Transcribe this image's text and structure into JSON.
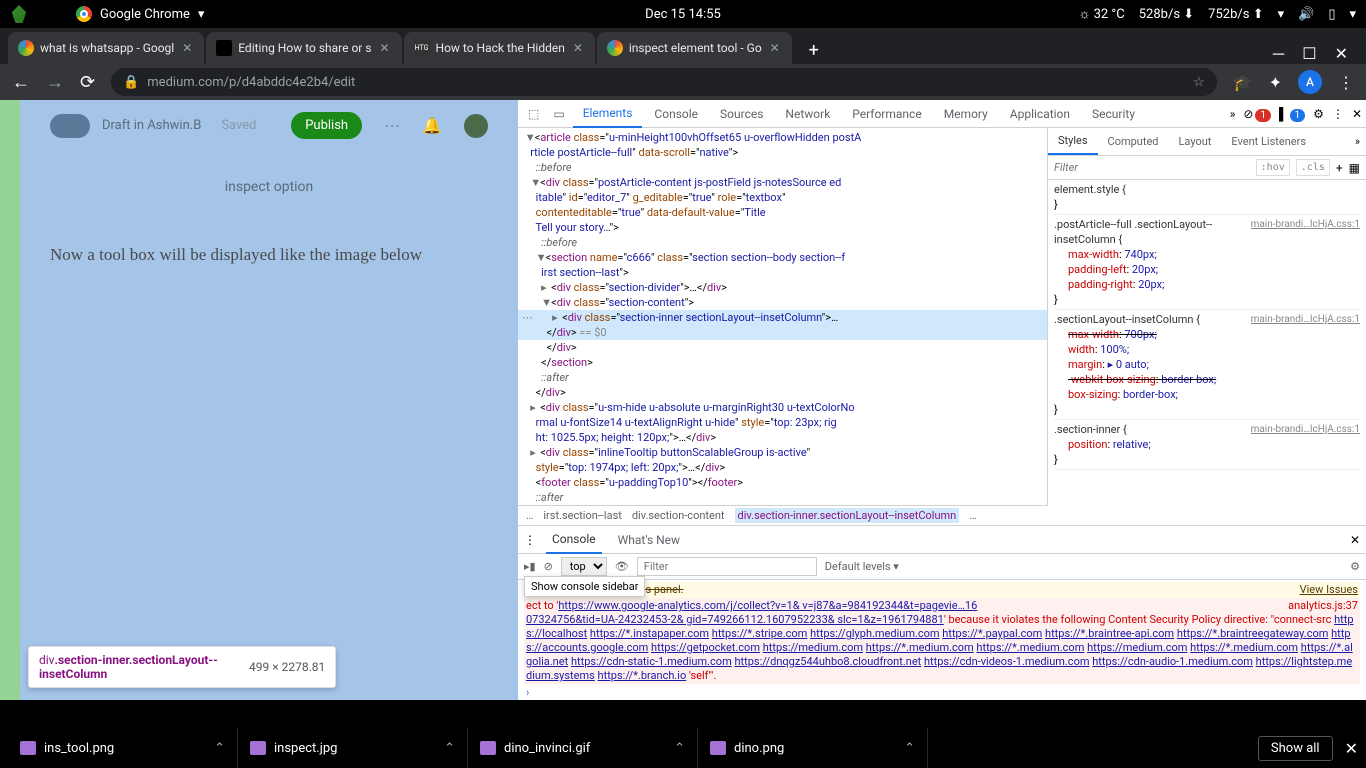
{
  "sysbar": {
    "app": "Google Chrome",
    "datetime": "Dec 15  14:55",
    "temp": "32 °C",
    "down": "528b/s",
    "up": "752b/s"
  },
  "tabs": [
    {
      "title": "what is whatsapp - Googl",
      "favicon": "google"
    },
    {
      "title": "Editing How to share or s",
      "favicon": "medium",
      "active": true
    },
    {
      "title": "How to Hack the Hidden",
      "favicon": "htg"
    },
    {
      "title": "inspect element tool - Go",
      "favicon": "google"
    }
  ],
  "url": "medium.com/p/d4abddc4e2b4/edit",
  "avatar_letter": "A",
  "medium": {
    "draft": "Draft in Ashwin.B",
    "saved": "Saved",
    "publish": "Publish",
    "inspect_label": "inspect option",
    "body_text": "Now a tool box will be displayed like the image below"
  },
  "hover_tooltip": {
    "tag": "div",
    "cls": ".section-inner.sectionLayout--insetColumn",
    "dims": "499 × 2278.81"
  },
  "devtools": {
    "tabs": [
      "Elements",
      "Console",
      "Sources",
      "Network",
      "Performance",
      "Memory",
      "Application",
      "Security"
    ],
    "active_tab": "Elements",
    "errors": "1",
    "issues": "1",
    "styles_tabs": [
      "Styles",
      "Computed",
      "Layout",
      "Event Listeners"
    ],
    "filter_ph": "Filter",
    "hov": ":hov",
    "cls": ".cls",
    "element_style": "element.style {",
    "rules": [
      {
        "src": "main-brandi…lcHjA.css:1",
        "sel": ".postArticle--full .sectionLayout--insetColumn {",
        "props": [
          {
            "n": "max-width",
            "v": "740px;"
          },
          {
            "n": "padding-left",
            "v": "20px;"
          },
          {
            "n": "padding-right",
            "v": "20px;"
          }
        ]
      },
      {
        "src": "main-brandi…lcHjA.css:1",
        "sel": ".sectionLayout--insetColumn {",
        "props": [
          {
            "n": "max-width",
            "v": "700px;",
            "strike": true
          },
          {
            "n": "width",
            "v": "100%;"
          },
          {
            "n": "margin",
            "v": "▸ 0 auto;"
          },
          {
            "n": "-webkit-box-sizing",
            "v": "border-box;",
            "strike": true
          },
          {
            "n": "box-sizing",
            "v": "border-box;"
          }
        ]
      },
      {
        "src": "main-brandi…lcHjA.css:1",
        "sel": ".section-inner {",
        "props": [
          {
            "n": "position",
            "v": "relative;"
          }
        ]
      }
    ],
    "breadcrumb": [
      "…",
      "irst.section--last",
      "div.section-content",
      "div.section-inner.sectionLayout--insetColumn",
      "…"
    ],
    "bc_selected": 3
  },
  "console": {
    "tabs": [
      "Console",
      "What's New"
    ],
    "context": "top",
    "filter_ph": "Filter",
    "levels": "Default levels",
    "sidebar_tip": "Show console sidebar",
    "issues_msg": "been moved to the Issues panel.",
    "view_issues": "View Issues",
    "err_pre": "ect to '",
    "err_url": "https://www.google-analytics.com/j/collect?v=1& v=j87&a=984192344&t=pagevie…16",
    "err_src": "analytics.js:37",
    "err_url2": "07324756&tid=UA-24232453-2& gid=749266112.1607952233& slc=1&z=1961794881",
    "err_mid": "' because it violates the following Content Security Policy directive: \"connect-src ",
    "allowed": [
      "https://localhost",
      "https://*.instapaper.com",
      "https://*.stripe.com",
      "https://glyph.medium.com",
      "https://*.paypal.com",
      "https://*.braintree-api.com",
      "https://*.braintreegateway.com",
      "https://accounts.google.com",
      "https://getpocket.com",
      "https://medium.com",
      "https://*.medium.com",
      "https://*.medium.com",
      "https://medium.com",
      "https://*.medium.com",
      "https://*.algolia.net",
      "https://cdn-static-1.medium.com",
      "https://dnqgz544uhbo8.cloudfront.net",
      "https://cdn-videos-1.medium.com",
      "https://cdn-audio-1.medium.com",
      "https://lightstep.medium.systems",
      "https://*.branch.io"
    ],
    "self": "'self'\"."
  },
  "taskbar": {
    "items": [
      "ins_tool.png",
      "inspect.jpg",
      "dino_invinci.gif",
      "dino.png"
    ],
    "showall": "Show all"
  }
}
